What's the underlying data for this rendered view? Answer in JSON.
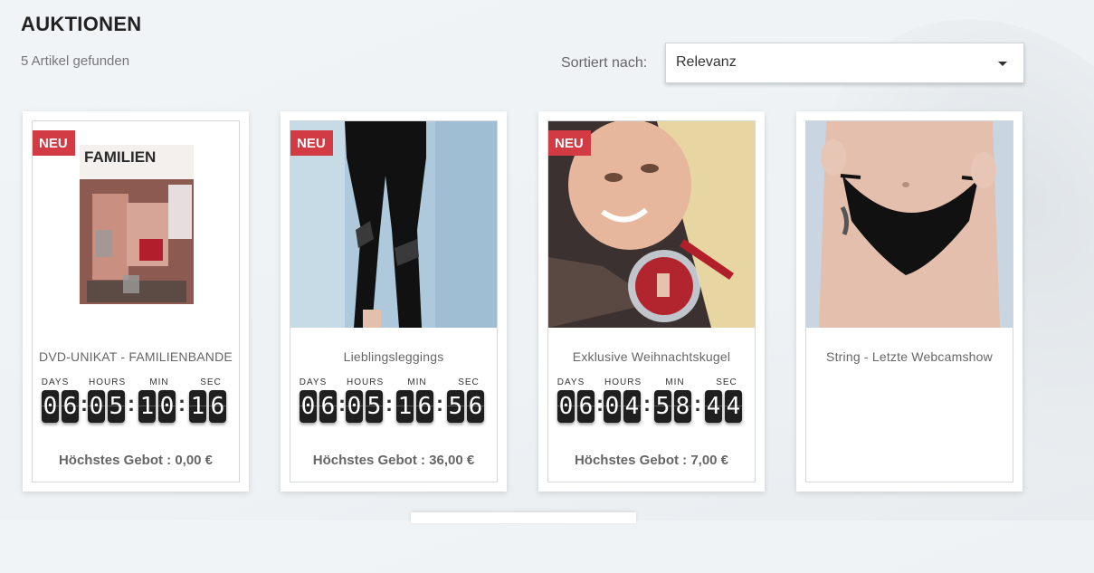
{
  "page": {
    "title": "AUKTIONEN",
    "result_count": "5 Artikel gefunden"
  },
  "sort": {
    "label": "Sortiert nach:",
    "selected": "Relevanz"
  },
  "countdown_labels": {
    "days": "DAYS",
    "hours": "HOURS",
    "min": "MIN",
    "sec": "SEC"
  },
  "colors": {
    "badge": "#d23a44",
    "digit_bg": "#1f1f1f"
  },
  "products": [
    {
      "badge": "NEU",
      "title": "DVD-UNIKAT - FAMILIENBANDE",
      "image_text": "FAMILIEN",
      "countdown": [
        "0",
        "6",
        "0",
        "5",
        "1",
        "0",
        "1",
        "6"
      ],
      "bid": "Höchstes Gebot : 0,00 €"
    },
    {
      "badge": "NEU",
      "title": "Lieblingsleggings",
      "countdown": [
        "0",
        "6",
        "0",
        "5",
        "1",
        "6",
        "5",
        "6"
      ],
      "bid": "Höchstes Gebot : 36,00 €"
    },
    {
      "badge": "NEU",
      "title": "Exklusive Weihnachtskugel",
      "countdown": [
        "0",
        "6",
        "0",
        "4",
        "5",
        "8",
        "4",
        "4"
      ],
      "bid": "Höchstes Gebot : 7,00 €"
    },
    {
      "title": "String - Letzte Webcamshow"
    }
  ]
}
